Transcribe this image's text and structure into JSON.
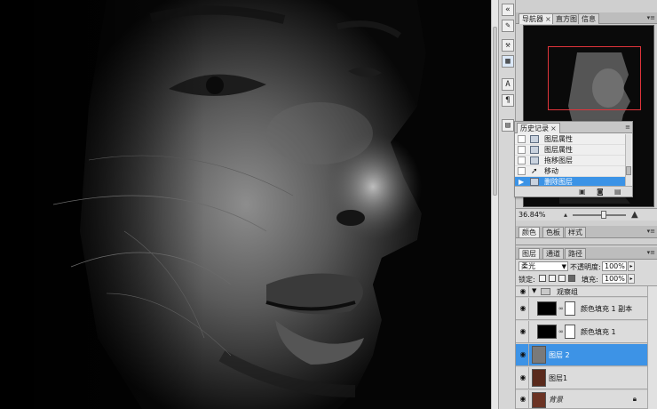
{
  "navigator": {
    "tabs": [
      "导航器",
      "直方图",
      "信息"
    ],
    "zoom": "36.84%"
  },
  "history": {
    "tab": "历史记录",
    "items": [
      {
        "label": "图层属性"
      },
      {
        "label": "图层属性"
      },
      {
        "label": "拖移图层"
      },
      {
        "label": "移动"
      },
      {
        "label": "删除图层"
      }
    ],
    "selected_index": 4
  },
  "color_panel": {
    "tabs": [
      "颜色",
      "色板",
      "样式"
    ]
  },
  "layers_panel": {
    "tabs": [
      "图层",
      "通道",
      "路径"
    ],
    "blend_mode": "柔光",
    "opacity_label": "不透明度:",
    "opacity_value": "100%",
    "lock_label": "锁定:",
    "fill_label": "填充:",
    "fill_value": "100%",
    "layers": [
      {
        "name": "观察组",
        "type": "group"
      },
      {
        "name": "颜色填充 1 副本",
        "type": "fill"
      },
      {
        "name": "颜色填充 1",
        "type": "fill"
      },
      {
        "name": "图层 2",
        "type": "pixel",
        "selected": true
      },
      {
        "name": "图层1",
        "type": "photo"
      },
      {
        "name": "背景",
        "type": "background",
        "locked": true
      }
    ]
  },
  "icons": {
    "close": "close-icon",
    "eye": "eye-icon",
    "chain": "link-icon",
    "folder": "folder-icon",
    "lock": "lock-icon"
  },
  "colors": {
    "selection_blue": "#3d93e6",
    "navigator_rect": "#e0343b"
  }
}
